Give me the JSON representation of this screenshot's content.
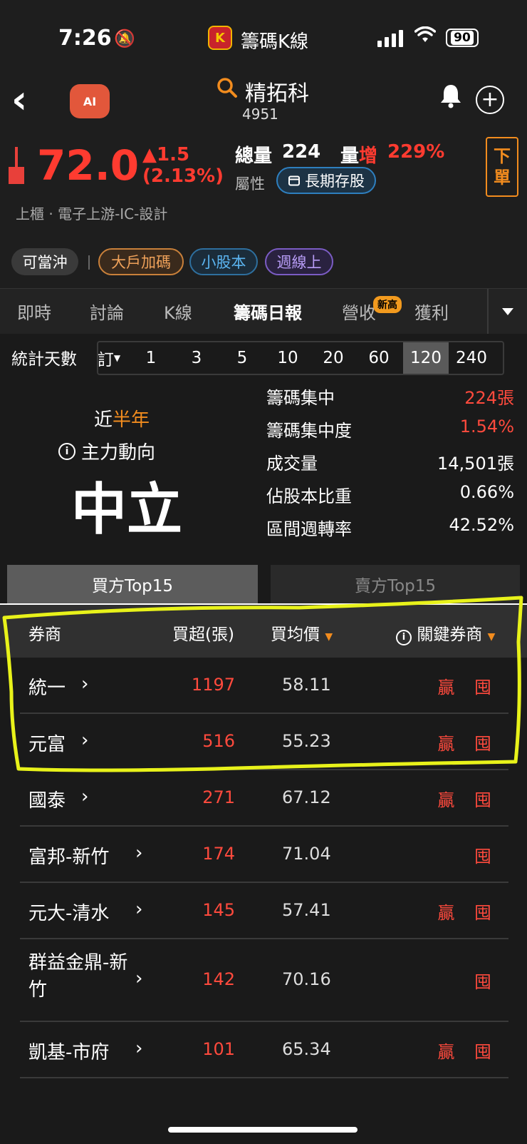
{
  "status_bar": {
    "time": "7:26",
    "app_name": "籌碼K線",
    "app_badge": "K",
    "battery": "90"
  },
  "header": {
    "stock_name": "精拓科",
    "stock_code": "4951",
    "ai_label": "AI"
  },
  "quote": {
    "price": "72.0",
    "change": "▲1.5",
    "change_pct": "(2.13%)",
    "volume_label": "總量",
    "volume": "224",
    "vol_inc_prefix": "量",
    "vol_inc_suffix": "增",
    "vol_inc_value": "229%",
    "attr_label": "屬性",
    "attr_tag": "長期存股",
    "order_line1": "下",
    "order_line2": "單",
    "industry": "上櫃 · 電子上游-IC-設計"
  },
  "tags": {
    "daytrade": "可當沖",
    "big": "大戶加碼",
    "small": "小股本",
    "week": "週線上"
  },
  "tabs": [
    {
      "label": "即時"
    },
    {
      "label": "討論"
    },
    {
      "label": "K線"
    },
    {
      "label": "籌碼日報"
    },
    {
      "label": "營收"
    },
    {
      "label": "獲利"
    }
  ],
  "new_badge": "新高",
  "days": {
    "label": "統計天數",
    "custom": "訂",
    "options": [
      "1",
      "3",
      "5",
      "10",
      "20",
      "60",
      "120",
      "240"
    ],
    "selected": "120"
  },
  "summary": {
    "near_prefix": "近",
    "near_period": "半年",
    "flow_label": "主力動向",
    "flow_value": "中立",
    "stats": [
      {
        "k": "籌碼集中",
        "v": "224張"
      },
      {
        "k": "籌碼集中度",
        "v": "1.54%"
      },
      {
        "k": "成交量",
        "v": "14,501張"
      },
      {
        "k": "佔股本比重",
        "v": "0.66%"
      },
      {
        "k": "區間週轉率",
        "v": "42.52%"
      }
    ]
  },
  "side_tabs": {
    "buy": "買方Top15",
    "sell": "賣方Top15"
  },
  "table": {
    "headers": {
      "broker": "券商",
      "net": "買超(張)",
      "avg": "買均價",
      "key": "關鍵券商"
    },
    "rows": [
      {
        "broker": "統一",
        "net": "1197",
        "avg": "58.11",
        "key": "贏 囤"
      },
      {
        "broker": "元富",
        "net": "516",
        "avg": "55.23",
        "key": "贏 囤"
      },
      {
        "broker": "國泰",
        "net": "271",
        "avg": "67.12",
        "key": "贏 囤"
      },
      {
        "broker": "富邦-新竹",
        "net": "174",
        "avg": "71.04",
        "key": "囤"
      },
      {
        "broker": "元大-清水",
        "net": "145",
        "avg": "57.41",
        "key": "贏 囤"
      },
      {
        "broker": "群益金鼎-新竹",
        "net": "142",
        "avg": "70.16",
        "key": "囤"
      },
      {
        "broker": "凱基-市府",
        "net": "101",
        "avg": "65.34",
        "key": "贏 囤"
      }
    ]
  },
  "colors": {
    "up": "#ff3b30",
    "accent": "#f28c1e",
    "highlight": "#e8f21a"
  }
}
